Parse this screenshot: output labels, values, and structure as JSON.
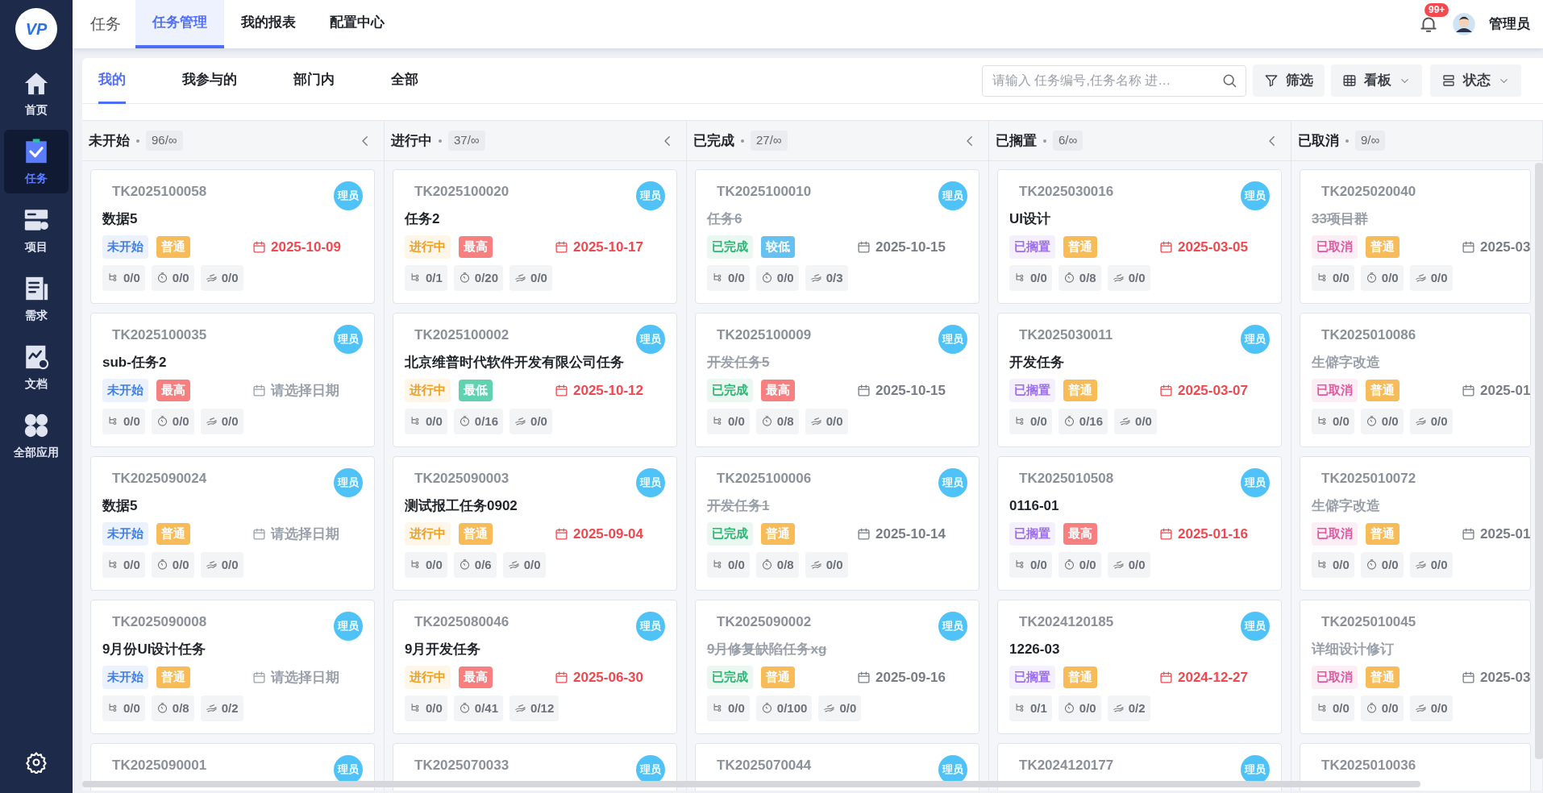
{
  "sidebar": {
    "logo": "VP",
    "items": [
      {
        "label": "首页",
        "selected": false
      },
      {
        "label": "任务",
        "selected": true
      },
      {
        "label": "项目",
        "selected": false
      },
      {
        "label": "需求",
        "selected": false
      },
      {
        "label": "文档",
        "selected": false
      },
      {
        "label": "全部应用",
        "selected": false
      }
    ]
  },
  "topbar": {
    "title": "任务",
    "tabs": [
      {
        "label": "任务管理",
        "selected": true
      },
      {
        "label": "我的报表",
        "selected": false
      },
      {
        "label": "配置中心",
        "selected": false
      }
    ],
    "notifications": "99+",
    "user": "管理员"
  },
  "subtabs": [
    {
      "label": "我的",
      "selected": true
    },
    {
      "label": "我参与的",
      "selected": false
    },
    {
      "label": "部门内",
      "selected": false
    },
    {
      "label": "全部",
      "selected": false
    }
  ],
  "search": {
    "placeholder": "请输入 任务编号,任务名称 进…"
  },
  "tools": [
    {
      "kind": "filter",
      "label": "筛选"
    },
    {
      "kind": "board",
      "label": "看板"
    },
    {
      "kind": "status",
      "label": "状态"
    }
  ],
  "columns": [
    {
      "title": "未开始",
      "count": "96/∞",
      "collapse_button": true,
      "cards": [
        {
          "id": "TK2025100058",
          "assignee": "理员",
          "title": "数据5",
          "crossed_out": false,
          "muted": false,
          "status": {
            "text": "未开始",
            "color": "#3d7ee8"
          },
          "priority": {
            "text": "普通",
            "color": "#f7bb58"
          },
          "date": {
            "value": "2025-10-09",
            "overdue": true
          },
          "stats": [
            "0/0",
            "0/0",
            "0/0"
          ]
        },
        {
          "id": "TK2025100035",
          "assignee": "理员",
          "title": "sub-任务2",
          "crossed_out": false,
          "muted": false,
          "status": {
            "text": "未开始",
            "color": "#3d7ee8"
          },
          "priority": {
            "text": "最高",
            "color": "#f77f7f"
          },
          "date": {
            "placeholder": "请选择日期"
          },
          "stats": [
            "0/0",
            "0/0",
            "0/0"
          ]
        },
        {
          "id": "TK2025090024",
          "assignee": "理员",
          "title": "数据5",
          "crossed_out": false,
          "muted": false,
          "status": {
            "text": "未开始",
            "color": "#3d7ee8"
          },
          "priority": {
            "text": "普通",
            "color": "#f7bb58"
          },
          "date": {
            "placeholder": "请选择日期"
          },
          "stats": [
            "0/0",
            "0/0",
            "0/0"
          ]
        },
        {
          "id": "TK2025090008",
          "assignee": "理员",
          "title": "9月份UI设计任务",
          "crossed_out": false,
          "muted": false,
          "status": {
            "text": "未开始",
            "color": "#3d7ee8"
          },
          "priority": {
            "text": "普通",
            "color": "#f7bb58"
          },
          "date": {
            "placeholder": "请选择日期"
          },
          "stats": [
            "0/0",
            "0/8",
            "0/2"
          ]
        },
        {
          "id": "TK2025090001",
          "assignee": "理员"
        }
      ]
    },
    {
      "title": "进行中",
      "count": "37/∞",
      "collapse_button": true,
      "cards": [
        {
          "id": "TK2025100020",
          "assignee": "理员",
          "title": "任务2",
          "crossed_out": false,
          "muted": false,
          "status": {
            "text": "进行中",
            "color": "#f0a020"
          },
          "priority": {
            "text": "最高",
            "color": "#f77f7f"
          },
          "date": {
            "value": "2025-10-17",
            "overdue": true
          },
          "stats": [
            "0/1",
            "0/20",
            "0/0"
          ]
        },
        {
          "id": "TK2025100002",
          "assignee": "理员",
          "title": "北京维普时代软件开发有限公司任务",
          "crossed_out": false,
          "muted": false,
          "status": {
            "text": "进行中",
            "color": "#f0a020"
          },
          "priority": {
            "text": "最低",
            "color": "#5fd3b0"
          },
          "date": {
            "value": "2025-10-12",
            "overdue": true
          },
          "stats": [
            "0/0",
            "0/16",
            "0/0"
          ]
        },
        {
          "id": "TK2025090003",
          "assignee": "理员",
          "title": "测试报工任务0902",
          "crossed_out": false,
          "muted": false,
          "status": {
            "text": "进行中",
            "color": "#f0a020"
          },
          "priority": {
            "text": "普通",
            "color": "#f7bb58"
          },
          "date": {
            "value": "2025-09-04",
            "overdue": true
          },
          "stats": [
            "0/0",
            "0/6",
            "0/0"
          ]
        },
        {
          "id": "TK2025080046",
          "assignee": "理员",
          "title": "9月开发任务",
          "crossed_out": false,
          "muted": false,
          "status": {
            "text": "进行中",
            "color": "#f0a020"
          },
          "priority": {
            "text": "最高",
            "color": "#f77f7f"
          },
          "date": {
            "value": "2025-06-30",
            "overdue": true
          },
          "stats": [
            "0/0",
            "0/41",
            "0/12"
          ]
        },
        {
          "id": "TK2025070033",
          "assignee": "理员"
        }
      ]
    },
    {
      "title": "已完成",
      "count": "27/∞",
      "collapse_button": true,
      "cards": [
        {
          "id": "TK2025100010",
          "assignee": "理员",
          "title": "任务6",
          "crossed_out": true,
          "muted": true,
          "status": {
            "text": "已完成",
            "color": "#2bb673"
          },
          "priority": {
            "text": "较低",
            "color": "#66c1f0"
          },
          "date": {
            "value": "2025-10-15",
            "overdue": false
          },
          "stats": [
            "0/0",
            "0/0",
            "0/3"
          ]
        },
        {
          "id": "TK2025100009",
          "assignee": "理员",
          "title": "开发任务5",
          "crossed_out": true,
          "muted": true,
          "status": {
            "text": "已完成",
            "color": "#2bb673"
          },
          "priority": {
            "text": "最高",
            "color": "#f77f7f"
          },
          "date": {
            "value": "2025-10-15",
            "overdue": false
          },
          "stats": [
            "0/0",
            "0/8",
            "0/0"
          ]
        },
        {
          "id": "TK2025100006",
          "assignee": "理员",
          "title": "开发任务1",
          "crossed_out": true,
          "muted": true,
          "status": {
            "text": "已完成",
            "color": "#2bb673"
          },
          "priority": {
            "text": "普通",
            "color": "#f7bb58"
          },
          "date": {
            "value": "2025-10-14",
            "overdue": false
          },
          "stats": [
            "0/0",
            "0/8",
            "0/0"
          ]
        },
        {
          "id": "TK2025090002",
          "assignee": "理员",
          "title": "9月修复缺陷任务xg",
          "crossed_out": true,
          "muted": true,
          "status": {
            "text": "已完成",
            "color": "#2bb673"
          },
          "priority": {
            "text": "普通",
            "color": "#f7bb58"
          },
          "date": {
            "value": "2025-09-16",
            "overdue": false
          },
          "stats": [
            "0/0",
            "0/100",
            "0/0"
          ]
        },
        {
          "id": "TK2025070044",
          "assignee": "理员"
        }
      ]
    },
    {
      "title": "已搁置",
      "count": "6/∞",
      "collapse_button": true,
      "cards": [
        {
          "id": "TK2025030016",
          "assignee": "理员",
          "title": "UI设计",
          "crossed_out": false,
          "muted": false,
          "status": {
            "text": "已搁置",
            "color": "#9b6cf0"
          },
          "priority": {
            "text": "普通",
            "color": "#f7bb58"
          },
          "date": {
            "value": "2025-03-05",
            "overdue": true
          },
          "stats": [
            "0/0",
            "0/8",
            "0/0"
          ]
        },
        {
          "id": "TK2025030011",
          "assignee": "理员",
          "title": "开发任务",
          "crossed_out": false,
          "muted": false,
          "status": {
            "text": "已搁置",
            "color": "#9b6cf0"
          },
          "priority": {
            "text": "普通",
            "color": "#f7bb58"
          },
          "date": {
            "value": "2025-03-07",
            "overdue": true
          },
          "stats": [
            "0/0",
            "0/16",
            "0/0"
          ]
        },
        {
          "id": "TK2025010508",
          "assignee": "理员",
          "title": "0116-01",
          "crossed_out": false,
          "muted": false,
          "status": {
            "text": "已搁置",
            "color": "#9b6cf0"
          },
          "priority": {
            "text": "最高",
            "color": "#f77f7f"
          },
          "date": {
            "value": "2025-01-16",
            "overdue": true
          },
          "stats": [
            "0/0",
            "0/0",
            "0/0"
          ]
        },
        {
          "id": "TK2024120185",
          "assignee": "理员",
          "title": "1226-03",
          "crossed_out": false,
          "muted": false,
          "status": {
            "text": "已搁置",
            "color": "#9b6cf0"
          },
          "priority": {
            "text": "普通",
            "color": "#f7bb58"
          },
          "date": {
            "value": "2024-12-27",
            "overdue": true
          },
          "stats": [
            "0/1",
            "0/0",
            "0/2"
          ]
        },
        {
          "id": "TK2024120177",
          "assignee": "理员"
        }
      ]
    },
    {
      "title": "已取消",
      "count": "9/∞",
      "collapse_button": false,
      "cards": [
        {
          "id": "TK2025020040",
          "title": "33项目群",
          "crossed_out": true,
          "muted": true,
          "status": {
            "text": "已取消",
            "color": "#e4559f"
          },
          "priority": {
            "text": "普通",
            "color": "#f7bb58"
          },
          "date": {
            "value": "2025-03",
            "overdue": false
          },
          "stats": [
            "0/0",
            "0/0",
            "0/0"
          ]
        },
        {
          "id": "TK2025010086",
          "title": "生僻字改造",
          "crossed_out": false,
          "muted": true,
          "status": {
            "text": "已取消",
            "color": "#e4559f"
          },
          "priority": {
            "text": "普通",
            "color": "#f7bb58"
          },
          "date": {
            "value": "2025-01",
            "overdue": false
          },
          "stats": [
            "0/0",
            "0/0",
            "0/0"
          ]
        },
        {
          "id": "TK2025010072",
          "title": "生僻字改造",
          "crossed_out": false,
          "muted": true,
          "status": {
            "text": "已取消",
            "color": "#e4559f"
          },
          "priority": {
            "text": "普通",
            "color": "#f7bb58"
          },
          "date": {
            "value": "2025-01",
            "overdue": false
          },
          "stats": [
            "0/0",
            "0/0",
            "0/0"
          ]
        },
        {
          "id": "TK2025010045",
          "title": "详细设计修订",
          "crossed_out": false,
          "muted": true,
          "status": {
            "text": "已取消",
            "color": "#e4559f"
          },
          "priority": {
            "text": "普通",
            "color": "#f7bb58"
          },
          "date": {
            "value": "2025-03",
            "overdue": false
          },
          "stats": [
            "0/0",
            "0/0",
            "0/0"
          ]
        },
        {
          "id": "TK2025010036"
        }
      ]
    }
  ]
}
